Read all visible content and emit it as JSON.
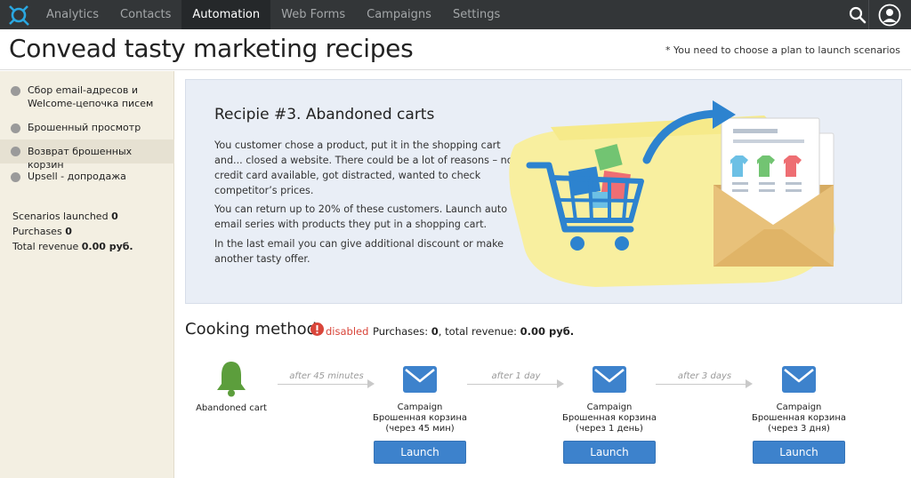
{
  "nav": {
    "items": [
      "Analytics",
      "Contacts",
      "Automation",
      "Web Forms",
      "Campaigns",
      "Settings"
    ],
    "active_index": 2
  },
  "header": {
    "title": "Convead tasty marketing recipes",
    "plan_note": "* You need to choose a plan to launch scenarios"
  },
  "sidebar": {
    "items": [
      {
        "label_line1": "Сбор email-адресов и",
        "label_line2": "Welcome-цепочка писем"
      },
      {
        "label_line1": "Брошенный просмотр",
        "label_line2": ""
      },
      {
        "label_line1": "Возврат брошенных корзин",
        "label_line2": ""
      },
      {
        "label_line1": "Upsell - допродажа",
        "label_line2": ""
      }
    ],
    "active_index": 2,
    "stats": {
      "scenarios_label": "Scenarios launched",
      "scenarios_value": "0",
      "purchases_label": "Purchases",
      "purchases_value": "0",
      "revenue_label": "Total revenue",
      "revenue_value": "0.00 руб."
    }
  },
  "recipe": {
    "title": "Recipie #3. Abandoned carts",
    "p1": "You customer chose a product, put it in the shopping cart and... closed a website. There could be a lot of reasons – no credit card available, got distracted, wanted to check competitor’s prices.",
    "p2": "You can return up to 20% of these customers. Launch auto email series with products they put in a shopping cart.",
    "p3": "In the last email you can give additional discount or make another tasty offer."
  },
  "cooking": {
    "title": "Cooking method",
    "status": "disabled",
    "purchases_label": "Purchases:",
    "purchases_value": "0",
    "revenue_label": ", total revenue:",
    "revenue_value": "0.00 руб."
  },
  "flow": {
    "trigger_label": "Abandoned cart",
    "delays": [
      "after 45 minutes",
      "after 1 day",
      "after 3 days"
    ],
    "campaigns": [
      {
        "line1": "Campaign",
        "line2": "Брошенная корзина",
        "line3": "(через 45 мин)",
        "button": "Launch"
      },
      {
        "line1": "Campaign",
        "line2": "Брошенная корзина",
        "line3": "(через 1 день)",
        "button": "Launch"
      },
      {
        "line1": "Campaign",
        "line2": "Брошенная корзина",
        "line3": "(через 3 дня)",
        "button": "Launch"
      }
    ]
  },
  "colors": {
    "topbar": "#333638",
    "sidebar": "#f3efe2",
    "accent_blue": "#3d82cc",
    "bell_green": "#5c9e3c",
    "disabled_red": "#d9453a"
  },
  "icons": [
    "logo-icon",
    "search-icon",
    "profile-icon",
    "bell-icon",
    "alert-icon",
    "envelope-icon"
  ]
}
